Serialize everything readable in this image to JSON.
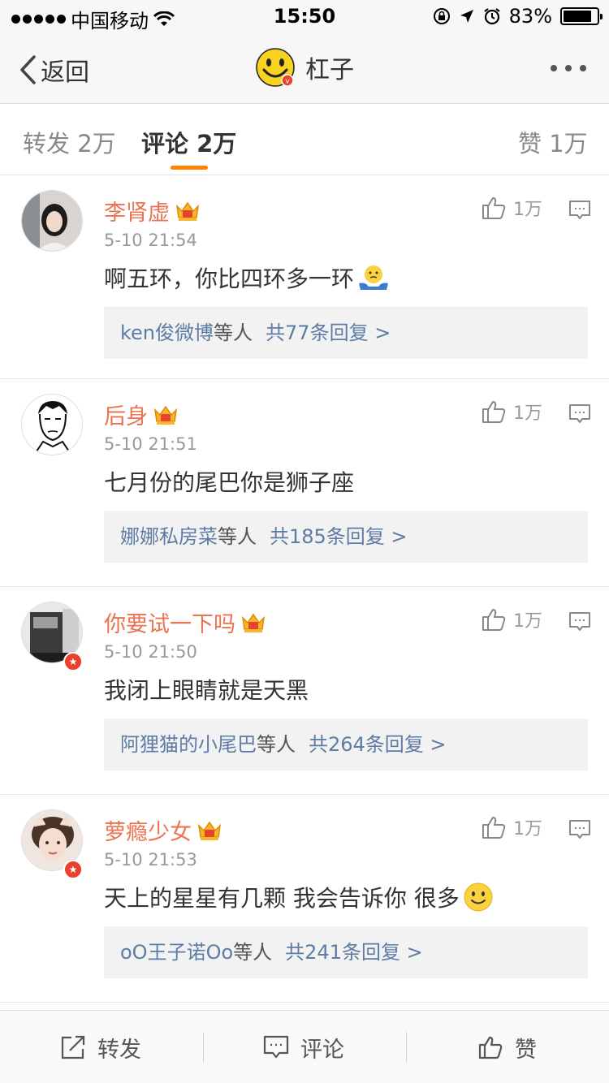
{
  "status_bar": {
    "carrier": "中国移动",
    "time": "15:50",
    "battery": "83%",
    "battery_level": 0.83
  },
  "nav": {
    "back_label": "返回",
    "title": "杠子",
    "more_icon": "more-dots-icon"
  },
  "tabs": [
    {
      "label": "转发",
      "count": "2万"
    },
    {
      "label": "评论",
      "count": "2万"
    },
    {
      "label": "赞",
      "count": "1万"
    }
  ],
  "comments": [
    {
      "name": "李肾虚",
      "time": "5-10 21:54",
      "text": "啊五环，你比四环多一环",
      "emoji": "shrug",
      "likes": "1万",
      "reply_names": "ken俊微博",
      "reply_others": "等人",
      "reply_count": "共77条回复 >"
    },
    {
      "name": "后身",
      "time": "5-10 21:51",
      "text": "七月份的尾巴你是狮子座",
      "emoji": "",
      "likes": "1万",
      "reply_names": "娜娜私房菜",
      "reply_others": "等人",
      "reply_count": "共185条回复 >"
    },
    {
      "name": "你要试一下吗",
      "time": "5-10 21:50",
      "text": "我闭上眼睛就是天黑",
      "emoji": "",
      "likes": "1万",
      "reply_names": "阿狸猫的小尾巴",
      "reply_others": "等人",
      "reply_count": "共264条回复 >"
    },
    {
      "name": "萝瘾少女",
      "time": "5-10 21:53",
      "text": "天上的星星有几颗 我会告诉你 很多",
      "emoji": "smile",
      "likes": "1万",
      "reply_names": "oO王子诺Oo",
      "reply_others": "等人",
      "reply_count": "共241条回复 >"
    }
  ],
  "toolbar": {
    "repost_label": "转发",
    "comment_label": "评论",
    "like_label": "赞"
  },
  "colors": {
    "accent": "#ff8200",
    "username": "#eb7350",
    "link": "#5d7ca5"
  }
}
